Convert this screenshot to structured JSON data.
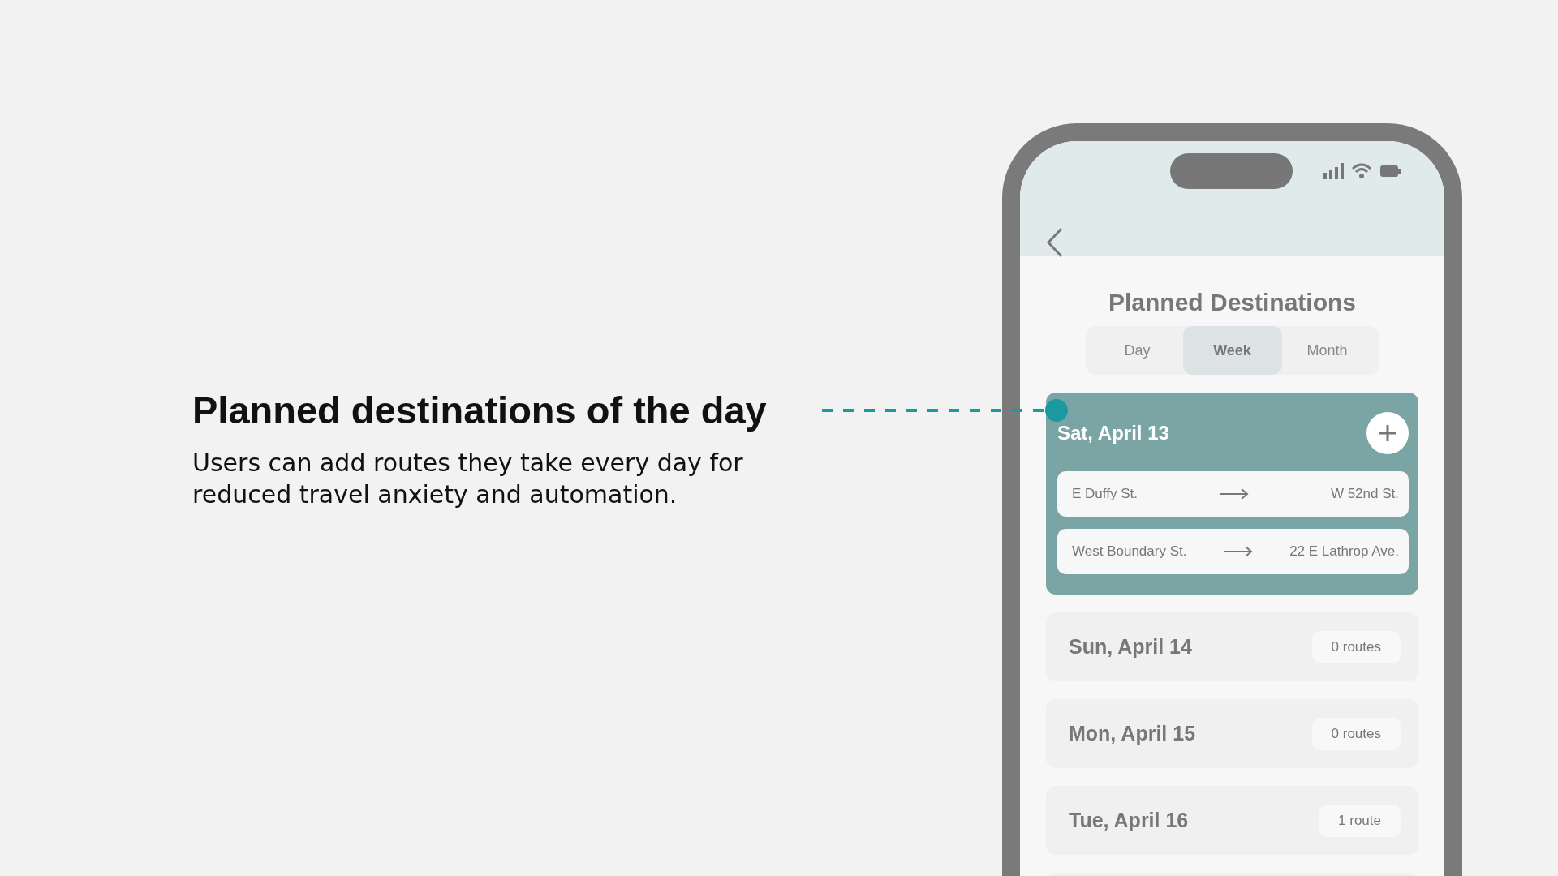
{
  "annotation": {
    "heading": "Planned destinations of the day",
    "body": "Users can add routes they take every day for reduced travel anxiety and automation."
  },
  "screen": {
    "title": "Planned Destinations",
    "tabs": [
      {
        "label": "Day",
        "selected": false
      },
      {
        "label": "Week",
        "selected": true
      },
      {
        "label": "Month",
        "selected": false
      }
    ],
    "days": [
      {
        "date": "Sat, April 13",
        "expanded": true,
        "routes": [
          {
            "from": "E Duffy St.",
            "to": "W 52nd St."
          },
          {
            "from": "West Boundary St.",
            "to": "22 E Lathrop Ave."
          }
        ]
      },
      {
        "date": "Sun, April 14",
        "expanded": false,
        "count": "0 routes"
      },
      {
        "date": "Mon, April 15",
        "expanded": false,
        "count": "0 routes"
      },
      {
        "date": "Tue, April 16",
        "expanded": false,
        "count": "1 route"
      }
    ]
  }
}
